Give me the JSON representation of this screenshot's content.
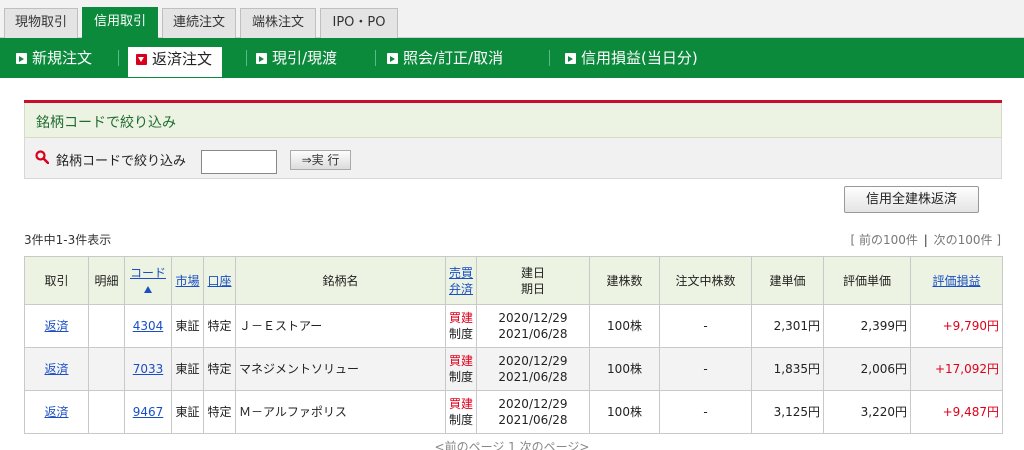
{
  "top_tabs": [
    {
      "label": "現物取引",
      "active": false
    },
    {
      "label": "信用取引",
      "active": true
    },
    {
      "label": "連続注文",
      "active": false
    },
    {
      "label": "端株注文",
      "active": false
    },
    {
      "label": "IPO・PO",
      "active": false
    }
  ],
  "sub_nav": [
    {
      "label": "新規注文",
      "active": false
    },
    {
      "label": "返済注文",
      "active": true
    },
    {
      "label": "現引/現渡",
      "active": false
    },
    {
      "label": "照会/訂正/取消",
      "active": false
    },
    {
      "label": "信用損益(当日分)",
      "active": false
    }
  ],
  "filter": {
    "title": "銘柄コードで絞り込み",
    "label": "銘柄コードで絞り込み",
    "input_value": "",
    "exec_label": "⇒実 行"
  },
  "all_return_button": "信用全建株返済",
  "count_text": "3件中1-3件表示",
  "paging": {
    "open": "[",
    "prev100": "前の100件",
    "sep": "|",
    "next100": "次の100件",
    "close": "]",
    "prev_page": "<前のページ",
    "current_page": "1",
    "next_page": "次のページ>"
  },
  "table": {
    "headers": {
      "trade": "取引",
      "detail": "明細",
      "code": "コード",
      "market": "市場",
      "account": "口座",
      "name": "銘柄名",
      "side_1": "売買",
      "side_2": "弁済",
      "date_1": "建日",
      "date_2": "期日",
      "qty": "建株数",
      "order_qty": "注文中株数",
      "unit_price": "建単価",
      "eval_price": "評価単価",
      "pl": "評価損益"
    },
    "rows": [
      {
        "trade": "返済",
        "detail": "",
        "code": "4304",
        "market": "東証",
        "account": "特定",
        "name": "Ｊ－Ｅストアー",
        "side": "買建",
        "repay": "制度",
        "open_date": "2020/12/29",
        "due_date": "2021/06/28",
        "qty": "100株",
        "order_qty": "-",
        "unit_price": "2,301円",
        "eval_price": "2,399円",
        "pl": "+9,790円"
      },
      {
        "trade": "返済",
        "detail": "",
        "code": "7033",
        "market": "東証",
        "account": "特定",
        "name": "マネジメントソリュー",
        "side": "買建",
        "repay": "制度",
        "open_date": "2020/12/29",
        "due_date": "2021/06/28",
        "qty": "100株",
        "order_qty": "-",
        "unit_price": "1,835円",
        "eval_price": "2,006円",
        "pl": "+17,092円"
      },
      {
        "trade": "返済",
        "detail": "",
        "code": "9467",
        "market": "東証",
        "account": "特定",
        "name": "Ｍ－アルファポリス",
        "side": "買建",
        "repay": "制度",
        "open_date": "2020/12/29",
        "due_date": "2021/06/28",
        "qty": "100株",
        "order_qty": "-",
        "unit_price": "3,125円",
        "eval_price": "3,220円",
        "pl": "+9,487円"
      }
    ]
  },
  "colors": {
    "brand_green": "#0b8a3c",
    "accent_red": "#c8102e",
    "link_blue": "#1a4fc4",
    "gain_red": "#e0001b"
  }
}
